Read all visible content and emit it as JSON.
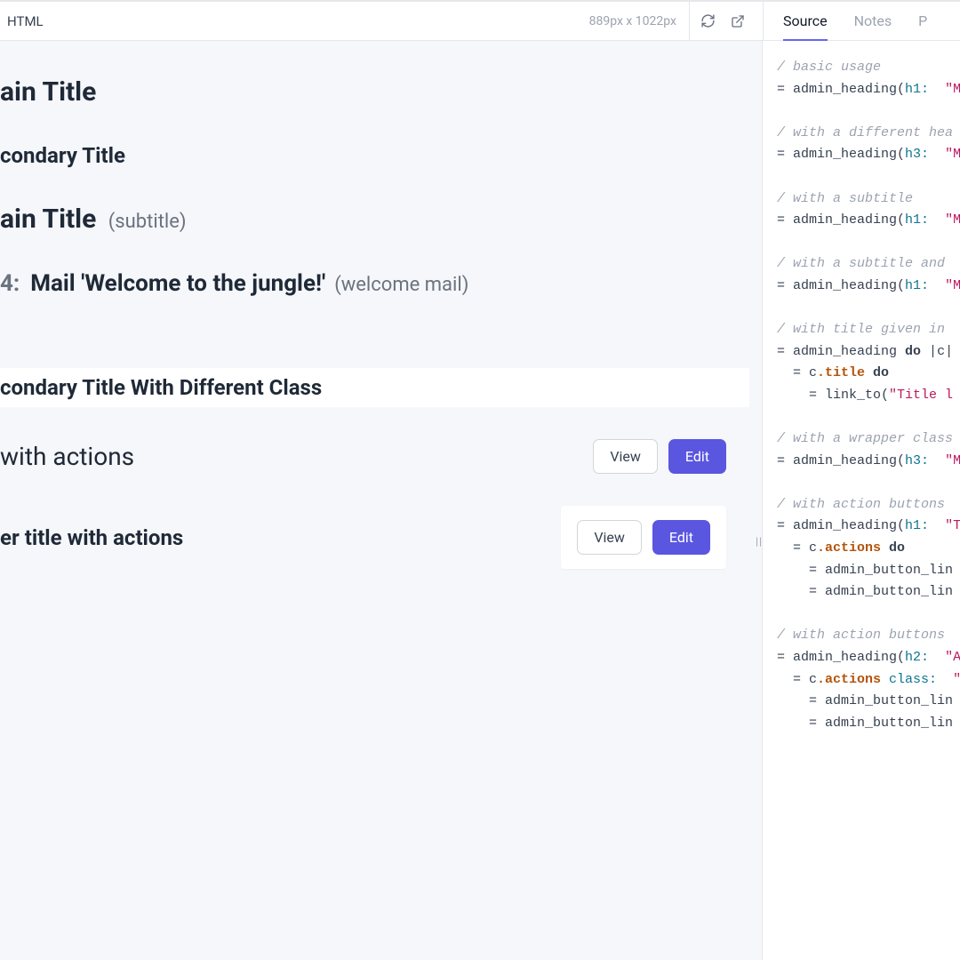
{
  "topbar": {
    "format": "HTML",
    "dimensions": "889px x 1022px"
  },
  "tabs": {
    "source": "Source",
    "notes": "Notes",
    "params": "P"
  },
  "preview": {
    "h1a": "ain Title",
    "h2a": "condary Title",
    "h1b": "ain Title",
    "h1b_sub": "(subtitle)",
    "mail_prefix": "4:",
    "mail_title": "Mail 'Welcome to the jungle!'",
    "mail_sub": "(welcome mail)",
    "boxed": "condary Title With Different Class",
    "actions1": "with actions",
    "actions2": "er title with actions",
    "view": "View",
    "edit": "Edit"
  },
  "code": {
    "c1": "/ basic usage",
    "l1a": "= admin_heading(",
    "l1b": "h1:",
    "l1c": "\"M",
    "c2": "/ with a different hea",
    "l2a": "= admin_heading(",
    "l2b": "h3:",
    "l2c": "\"M",
    "c3": "/ with a subtitle",
    "l3a": "= admin_heading(",
    "l3b": "h1:",
    "l3c": "\"M",
    "c4": "/ with a subtitle and ",
    "l4a": "= admin_heading(",
    "l4b": "h1:",
    "l4c": "\"M",
    "c5": "/ with title given in ",
    "l5a": "= admin_heading ",
    "l5b": "do ",
    "l5c": "|",
    "l5d": "c",
    "l5e": "|",
    "l6a": "  = c",
    "l6b": ".title",
    "l6c": " do",
    "l7a": "    = link_to(",
    "l7b": "\"Title l",
    "c6": "/ with a wrapper class",
    "l8a": "= admin_heading(",
    "l8b": "h3:",
    "l8c": "\"M",
    "c7": "/ with action buttons",
    "l9a": "= admin_heading(",
    "l9b": "h1:",
    "l9c": "\"T",
    "l10a": "  = c",
    "l10b": ".actions",
    "l10c": " do",
    "l11": "    = admin_button_lin",
    "l12": "    = admin_button_lin",
    "c8": "/ with action buttons ",
    "l13a": "= admin_heading(",
    "l13b": "h2:",
    "l13c": "\"A",
    "l14a": "  = c",
    "l14b": ".actions",
    "l14c": " class:",
    "l14d": " \"",
    "l15": "    = admin_button_lin",
    "l16": "    = admin_button_lin"
  }
}
